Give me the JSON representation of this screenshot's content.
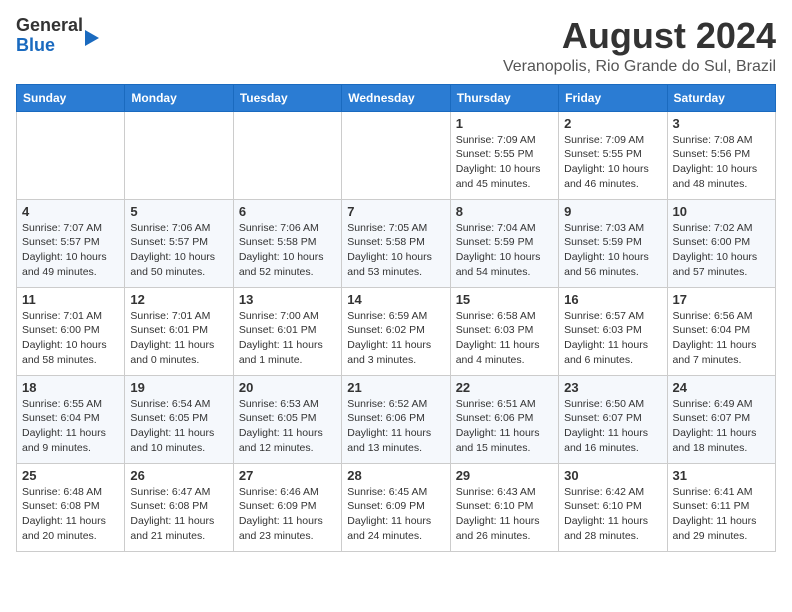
{
  "header": {
    "logo_general": "General",
    "logo_blue": "Blue",
    "month_title": "August 2024",
    "location": "Veranopolis, Rio Grande do Sul, Brazil"
  },
  "days_of_week": [
    "Sunday",
    "Monday",
    "Tuesday",
    "Wednesday",
    "Thursday",
    "Friday",
    "Saturday"
  ],
  "weeks": [
    [
      {
        "day": "",
        "info": ""
      },
      {
        "day": "",
        "info": ""
      },
      {
        "day": "",
        "info": ""
      },
      {
        "day": "",
        "info": ""
      },
      {
        "day": "1",
        "info": "Sunrise: 7:09 AM\nSunset: 5:55 PM\nDaylight: 10 hours\nand 45 minutes."
      },
      {
        "day": "2",
        "info": "Sunrise: 7:09 AM\nSunset: 5:55 PM\nDaylight: 10 hours\nand 46 minutes."
      },
      {
        "day": "3",
        "info": "Sunrise: 7:08 AM\nSunset: 5:56 PM\nDaylight: 10 hours\nand 48 minutes."
      }
    ],
    [
      {
        "day": "4",
        "info": "Sunrise: 7:07 AM\nSunset: 5:57 PM\nDaylight: 10 hours\nand 49 minutes."
      },
      {
        "day": "5",
        "info": "Sunrise: 7:06 AM\nSunset: 5:57 PM\nDaylight: 10 hours\nand 50 minutes."
      },
      {
        "day": "6",
        "info": "Sunrise: 7:06 AM\nSunset: 5:58 PM\nDaylight: 10 hours\nand 52 minutes."
      },
      {
        "day": "7",
        "info": "Sunrise: 7:05 AM\nSunset: 5:58 PM\nDaylight: 10 hours\nand 53 minutes."
      },
      {
        "day": "8",
        "info": "Sunrise: 7:04 AM\nSunset: 5:59 PM\nDaylight: 10 hours\nand 54 minutes."
      },
      {
        "day": "9",
        "info": "Sunrise: 7:03 AM\nSunset: 5:59 PM\nDaylight: 10 hours\nand 56 minutes."
      },
      {
        "day": "10",
        "info": "Sunrise: 7:02 AM\nSunset: 6:00 PM\nDaylight: 10 hours\nand 57 minutes."
      }
    ],
    [
      {
        "day": "11",
        "info": "Sunrise: 7:01 AM\nSunset: 6:00 PM\nDaylight: 10 hours\nand 58 minutes."
      },
      {
        "day": "12",
        "info": "Sunrise: 7:01 AM\nSunset: 6:01 PM\nDaylight: 11 hours\nand 0 minutes."
      },
      {
        "day": "13",
        "info": "Sunrise: 7:00 AM\nSunset: 6:01 PM\nDaylight: 11 hours\nand 1 minute."
      },
      {
        "day": "14",
        "info": "Sunrise: 6:59 AM\nSunset: 6:02 PM\nDaylight: 11 hours\nand 3 minutes."
      },
      {
        "day": "15",
        "info": "Sunrise: 6:58 AM\nSunset: 6:03 PM\nDaylight: 11 hours\nand 4 minutes."
      },
      {
        "day": "16",
        "info": "Sunrise: 6:57 AM\nSunset: 6:03 PM\nDaylight: 11 hours\nand 6 minutes."
      },
      {
        "day": "17",
        "info": "Sunrise: 6:56 AM\nSunset: 6:04 PM\nDaylight: 11 hours\nand 7 minutes."
      }
    ],
    [
      {
        "day": "18",
        "info": "Sunrise: 6:55 AM\nSunset: 6:04 PM\nDaylight: 11 hours\nand 9 minutes."
      },
      {
        "day": "19",
        "info": "Sunrise: 6:54 AM\nSunset: 6:05 PM\nDaylight: 11 hours\nand 10 minutes."
      },
      {
        "day": "20",
        "info": "Sunrise: 6:53 AM\nSunset: 6:05 PM\nDaylight: 11 hours\nand 12 minutes."
      },
      {
        "day": "21",
        "info": "Sunrise: 6:52 AM\nSunset: 6:06 PM\nDaylight: 11 hours\nand 13 minutes."
      },
      {
        "day": "22",
        "info": "Sunrise: 6:51 AM\nSunset: 6:06 PM\nDaylight: 11 hours\nand 15 minutes."
      },
      {
        "day": "23",
        "info": "Sunrise: 6:50 AM\nSunset: 6:07 PM\nDaylight: 11 hours\nand 16 minutes."
      },
      {
        "day": "24",
        "info": "Sunrise: 6:49 AM\nSunset: 6:07 PM\nDaylight: 11 hours\nand 18 minutes."
      }
    ],
    [
      {
        "day": "25",
        "info": "Sunrise: 6:48 AM\nSunset: 6:08 PM\nDaylight: 11 hours\nand 20 minutes."
      },
      {
        "day": "26",
        "info": "Sunrise: 6:47 AM\nSunset: 6:08 PM\nDaylight: 11 hours\nand 21 minutes."
      },
      {
        "day": "27",
        "info": "Sunrise: 6:46 AM\nSunset: 6:09 PM\nDaylight: 11 hours\nand 23 minutes."
      },
      {
        "day": "28",
        "info": "Sunrise: 6:45 AM\nSunset: 6:09 PM\nDaylight: 11 hours\nand 24 minutes."
      },
      {
        "day": "29",
        "info": "Sunrise: 6:43 AM\nSunset: 6:10 PM\nDaylight: 11 hours\nand 26 minutes."
      },
      {
        "day": "30",
        "info": "Sunrise: 6:42 AM\nSunset: 6:10 PM\nDaylight: 11 hours\nand 28 minutes."
      },
      {
        "day": "31",
        "info": "Sunrise: 6:41 AM\nSunset: 6:11 PM\nDaylight: 11 hours\nand 29 minutes."
      }
    ]
  ]
}
